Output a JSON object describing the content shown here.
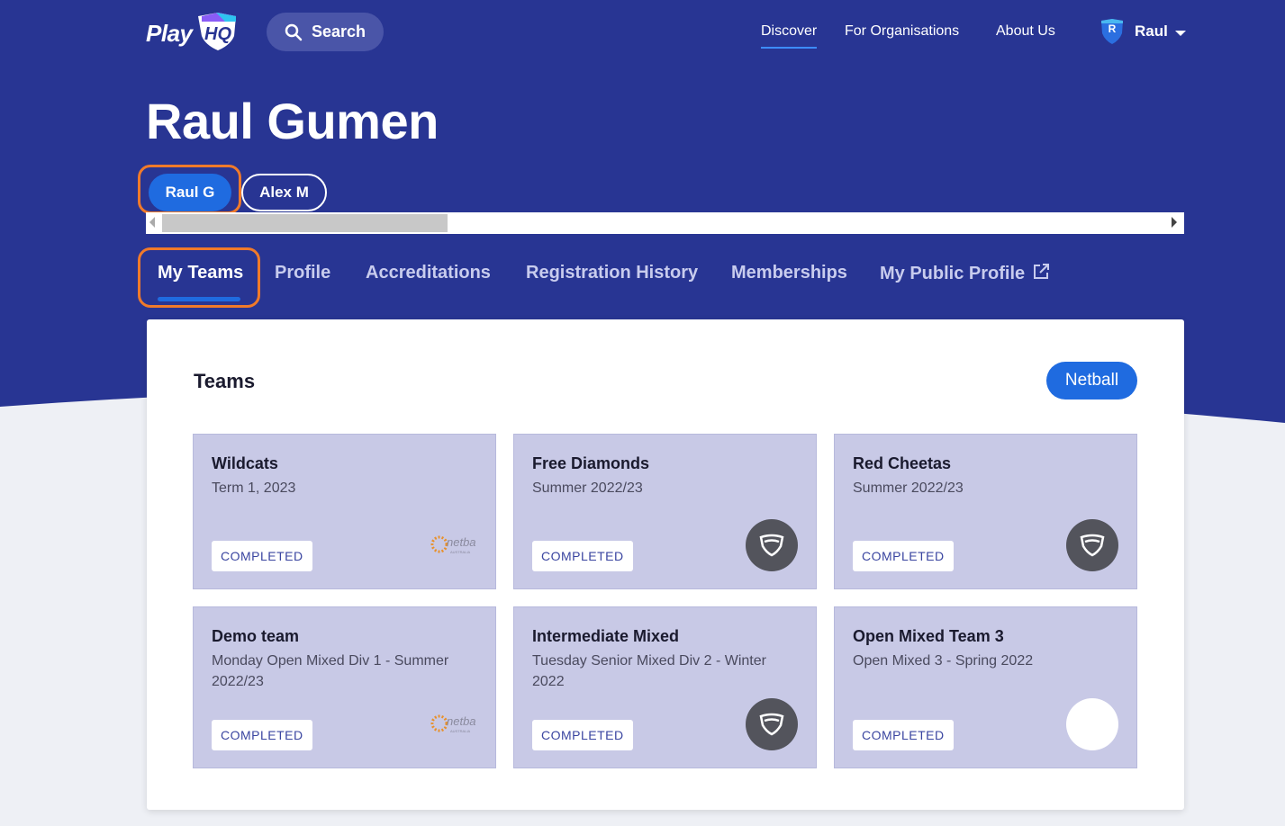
{
  "header": {
    "logo_text": "Play",
    "logo_mark": "HQ",
    "search_label": "Search",
    "nav": [
      {
        "label": "Discover",
        "active": true
      },
      {
        "label": "For Organisations",
        "active": false
      },
      {
        "label": "About Us",
        "active": false
      }
    ],
    "user": {
      "initial": "R",
      "name": "Raul"
    }
  },
  "profile": {
    "title": "Raul Gumen",
    "chips": [
      {
        "label": "Raul G",
        "active": true
      },
      {
        "label": "Alex M",
        "active": false
      }
    ]
  },
  "tabs": [
    {
      "label": "My Teams",
      "active": true
    },
    {
      "label": "Profile",
      "active": false
    },
    {
      "label": "Accreditations",
      "active": false
    },
    {
      "label": "Registration History",
      "active": false
    },
    {
      "label": "Memberships",
      "active": false
    },
    {
      "label": "My Public Profile",
      "active": false,
      "external": true
    }
  ],
  "teams_panel": {
    "title": "Teams",
    "sport_filter": "Netball",
    "teams": [
      {
        "name": "Wildcats",
        "sub": "Term 1, 2023",
        "status": "COMPLETED",
        "logo": "netball-logo"
      },
      {
        "name": "Free Diamonds",
        "sub": "Summer 2022/23",
        "status": "COMPLETED",
        "logo": "shield-icon"
      },
      {
        "name": "Red Cheetas",
        "sub": "Summer 2022/23",
        "status": "COMPLETED",
        "logo": "shield-icon"
      },
      {
        "name": "Demo team",
        "sub": "Monday Open Mixed Div 1 - Summer 2022/23",
        "status": "COMPLETED",
        "logo": "netball-logo"
      },
      {
        "name": "Intermediate Mixed",
        "sub": "Tuesday Senior Mixed Div 2 - Winter 2022",
        "status": "COMPLETED",
        "logo": "shield-icon"
      },
      {
        "name": "Open Mixed Team 3",
        "sub": "Open Mixed 3 - Spring 2022",
        "status": "COMPLETED",
        "logo": "blank-logo"
      }
    ]
  },
  "colors": {
    "brand_navy": "#283593",
    "accent_blue": "#1f6be0",
    "highlight_orange": "#f07a2a",
    "card_bg": "#c8c9e6"
  }
}
